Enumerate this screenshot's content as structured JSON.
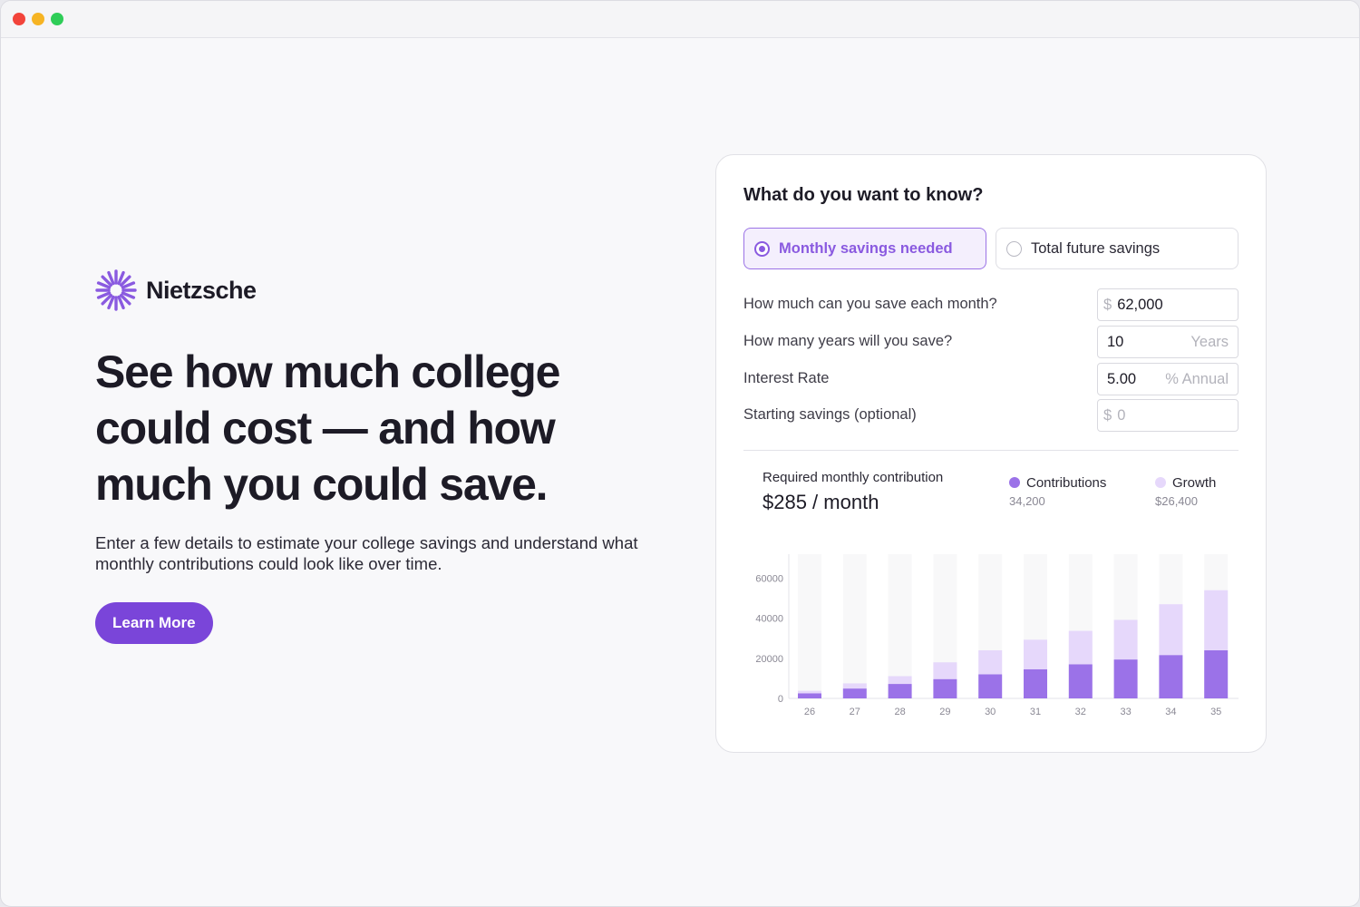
{
  "window": {
    "controls": [
      "close",
      "minimize",
      "maximize"
    ]
  },
  "brand": {
    "name": "Nietzsche",
    "logo_icon": "sunburst-logo-icon",
    "color": "#8a5ae0"
  },
  "hero": {
    "headline": "See how much college could cost — and how much you could save.",
    "lede": "Enter a few details to estimate your college savings and understand what monthly contributions could look like over time.",
    "cta_label": "Learn More",
    "cta_color": "#7a45d9"
  },
  "calculator": {
    "title": "What do you want to know?",
    "options": [
      {
        "label": "Monthly savings needed",
        "selected": true
      },
      {
        "label": "Total future savings",
        "selected": false
      }
    ],
    "fields": [
      {
        "label": "How much can you save each month?",
        "prefix": "$",
        "value": "62,000",
        "suffix": "",
        "placeholder": ""
      },
      {
        "label": "How many years will you save?",
        "prefix": "",
        "value": "10",
        "suffix": "Years",
        "placeholder": ""
      },
      {
        "label": "Interest Rate",
        "prefix": "",
        "value": "5.00",
        "suffix": "% Annual",
        "placeholder": ""
      },
      {
        "label": "Starting savings (optional)",
        "prefix": "$",
        "value": "",
        "suffix": "",
        "placeholder": "0"
      }
    ],
    "result": {
      "label": "Required monthly contribution",
      "value": "$285 / month"
    },
    "legend": [
      {
        "name": "Contributions",
        "value": "34,200",
        "color": "#9b72e8"
      },
      {
        "name": "Growth",
        "value": "$26,400",
        "color": "#e6d8fb"
      }
    ]
  },
  "chart_data": {
    "type": "bar",
    "stacked": true,
    "categories": [
      "26",
      "27",
      "28",
      "29",
      "30",
      "31",
      "32",
      "33",
      "34",
      "35"
    ],
    "series": [
      {
        "name": "Contributions",
        "values": [
          2500,
          4900,
          7200,
          9600,
          12000,
          14500,
          17000,
          19400,
          21600,
          24000
        ],
        "color": "#9b72e8"
      },
      {
        "name": "Growth",
        "values": [
          1300,
          2600,
          3900,
          8400,
          12000,
          14800,
          16700,
          19800,
          25400,
          30000
        ],
        "color": "#e6d8fb"
      }
    ],
    "yticks": [
      0,
      20000,
      40000,
      60000
    ],
    "ylim": [
      0,
      72000
    ],
    "background_bar_color": "#f8f8f9",
    "grid": false
  }
}
